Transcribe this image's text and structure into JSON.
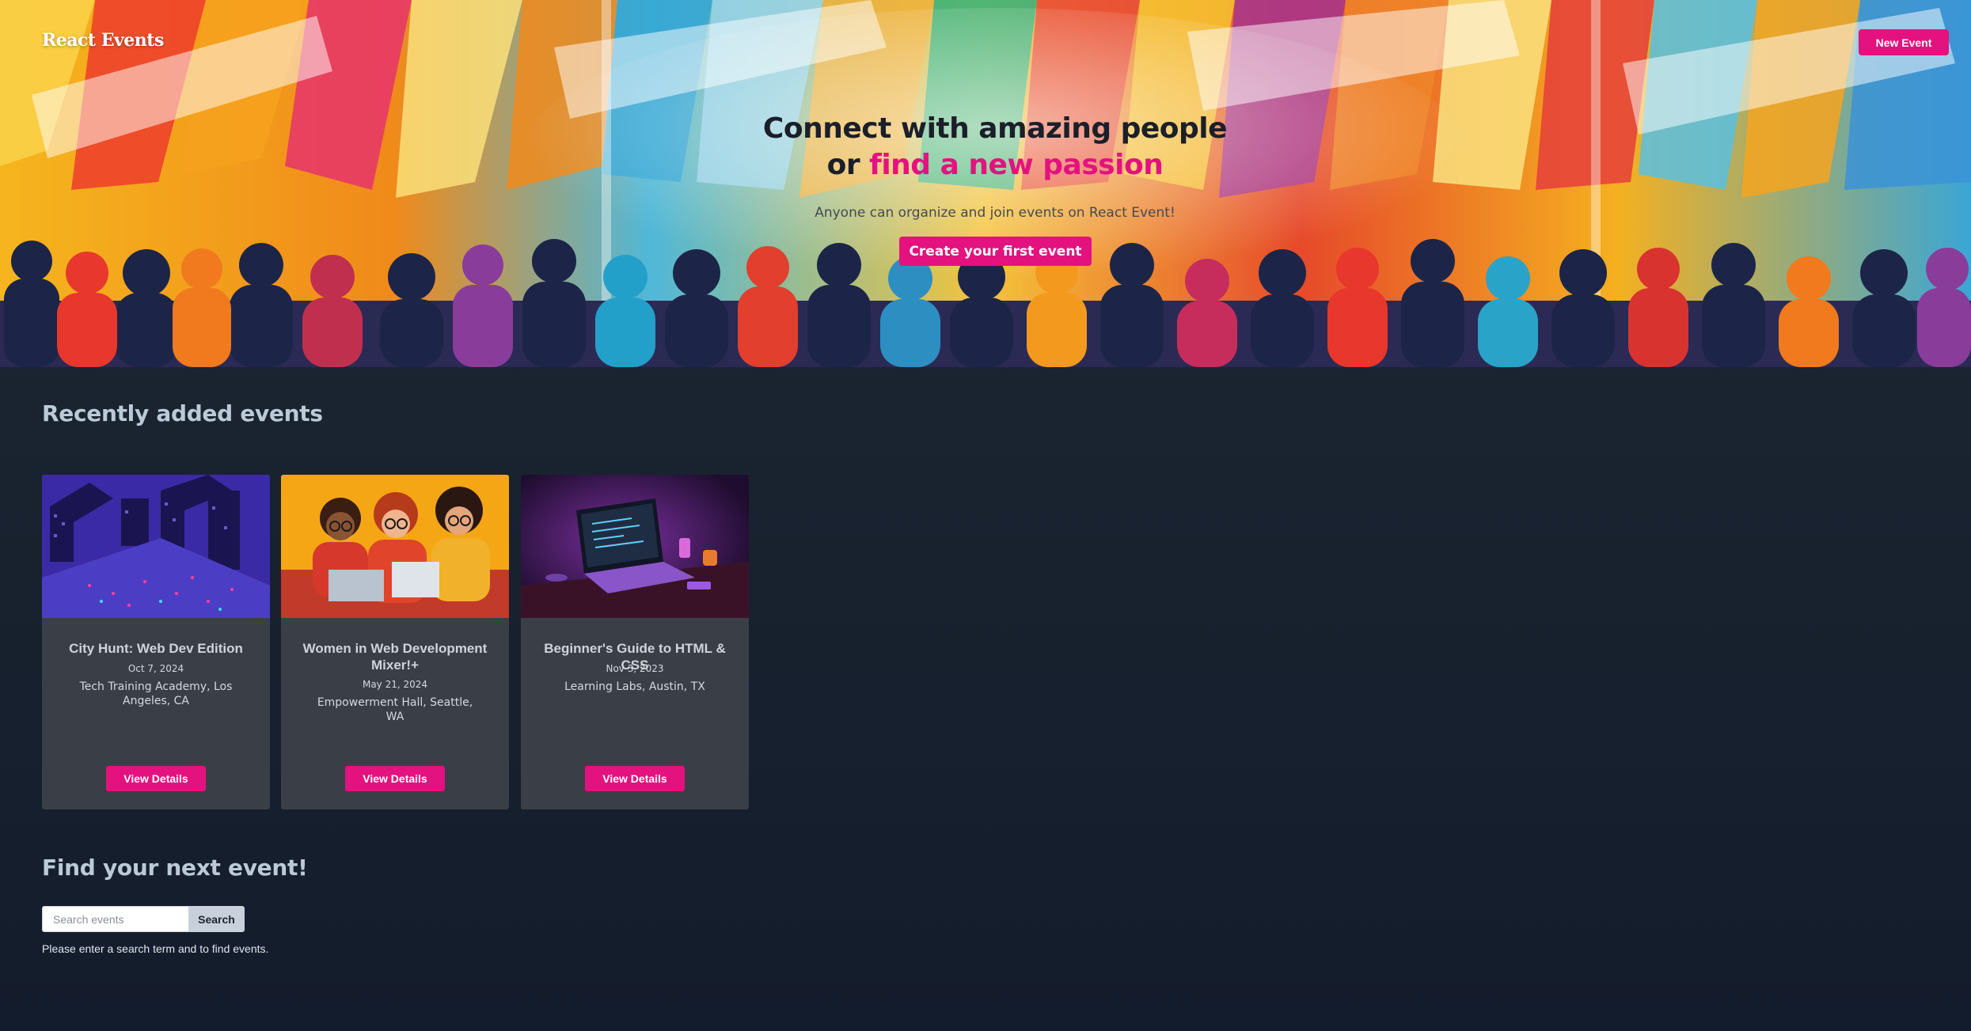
{
  "brand": "React Events",
  "header": {
    "new_event_label": "New Event"
  },
  "hero": {
    "headline_line1": "Connect with amazing people",
    "headline_or": "or",
    "headline_accent": "find a new passion",
    "subtitle": "Anyone can organize and join events on React Event!",
    "cta_label": "Create your first event"
  },
  "recent": {
    "title": "Recently added events",
    "cards": [
      {
        "title": "City Hunt: Web Dev Edition",
        "date": "Oct 7, 2024",
        "location": "Tech Training Academy, Los Angeles, CA",
        "button": "View Details",
        "image": "isometric-city-night"
      },
      {
        "title": "Women in Web Development Mixer!+",
        "date": "May 21, 2024",
        "location": "Empowerment Hall, Seattle, WA",
        "button": "View Details",
        "image": "women-with-laptops"
      },
      {
        "title": "Beginner's Guide to HTML & CSS",
        "date": "Nov 3, 2023",
        "location": "Learning Labs, Austin, TX",
        "button": "View Details",
        "image": "laptop-desk-purple"
      }
    ]
  },
  "find": {
    "title": "Find your next event!",
    "search_placeholder": "Search events",
    "search_value": "",
    "search_button": "Search",
    "hint": "Please enter a search term and to find events."
  },
  "colors": {
    "accent": "#e3127f",
    "background": "#1a2533",
    "card": "#3a3f47"
  }
}
